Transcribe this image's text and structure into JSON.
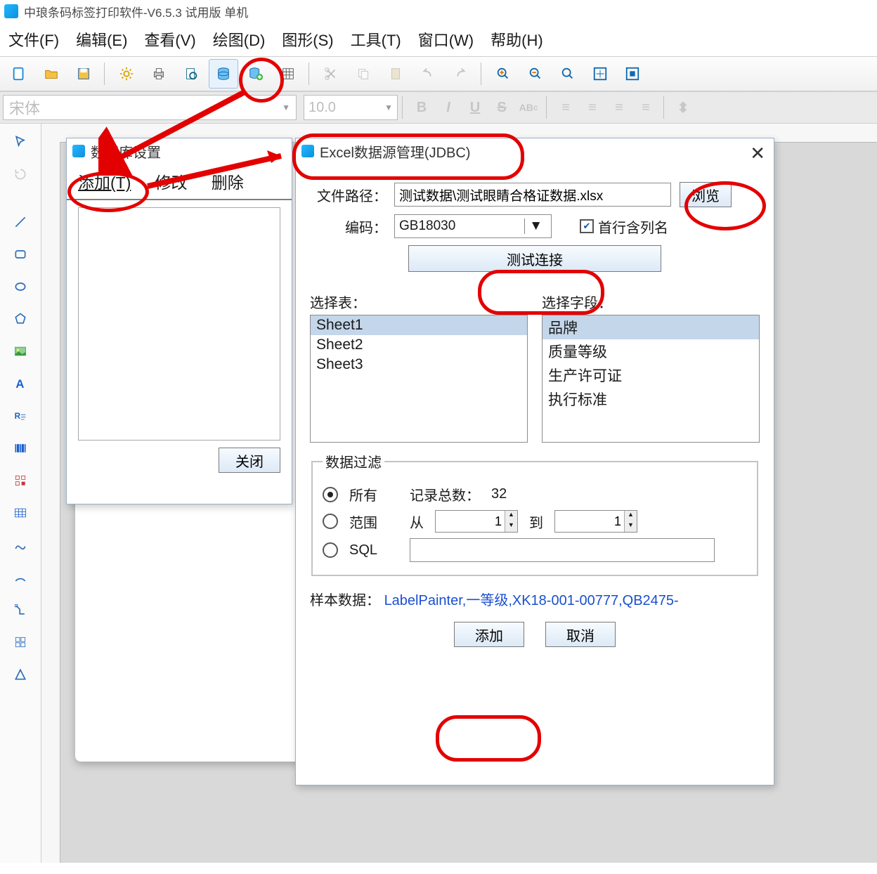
{
  "titlebar": {
    "text": "中琅条码标签打印软件-V6.5.3 试用版 单机"
  },
  "menu": {
    "file": "文件(F)",
    "edit": "编辑(E)",
    "view": "查看(V)",
    "draw": "绘图(D)",
    "shape": "图形(S)",
    "tool": "工具(T)",
    "window": "窗口(W)",
    "help": "帮助(H)"
  },
  "font": {
    "family": "宋体",
    "size": "10.0"
  },
  "dbdlg": {
    "title": "数据库设置",
    "add": "添加(T)",
    "modify": "修改",
    "delete": "删除",
    "close": "关闭"
  },
  "excdlg": {
    "title": "Excel数据源管理(JDBC)",
    "path_label": "文件路径：",
    "path_value": "测试数据\\测试眼睛合格证数据.xlsx",
    "browse": "浏览",
    "encoding_label": "编码：",
    "encoding_value": "GB18030",
    "header_row": "首行含列名",
    "test": "测试连接",
    "select_table": "选择表：",
    "select_field": "选择字段：",
    "tables": [
      "Sheet1",
      "Sheet2",
      "Sheet3"
    ],
    "fields": [
      "品牌",
      "质量等级",
      "生产许可证",
      "执行标准"
    ],
    "filter": {
      "legend": "数据过滤",
      "all": "所有",
      "range": "范围",
      "sql": "SQL",
      "count_label": "记录总数：",
      "count": "32",
      "from": "从",
      "to": "到",
      "from_v": "1",
      "to_v": "1"
    },
    "sample_label": "样本数据：",
    "sample_value": "LabelPainter,一等级,XK18-001-00777,QB2475-",
    "ok": "添加",
    "cancel": "取消"
  }
}
